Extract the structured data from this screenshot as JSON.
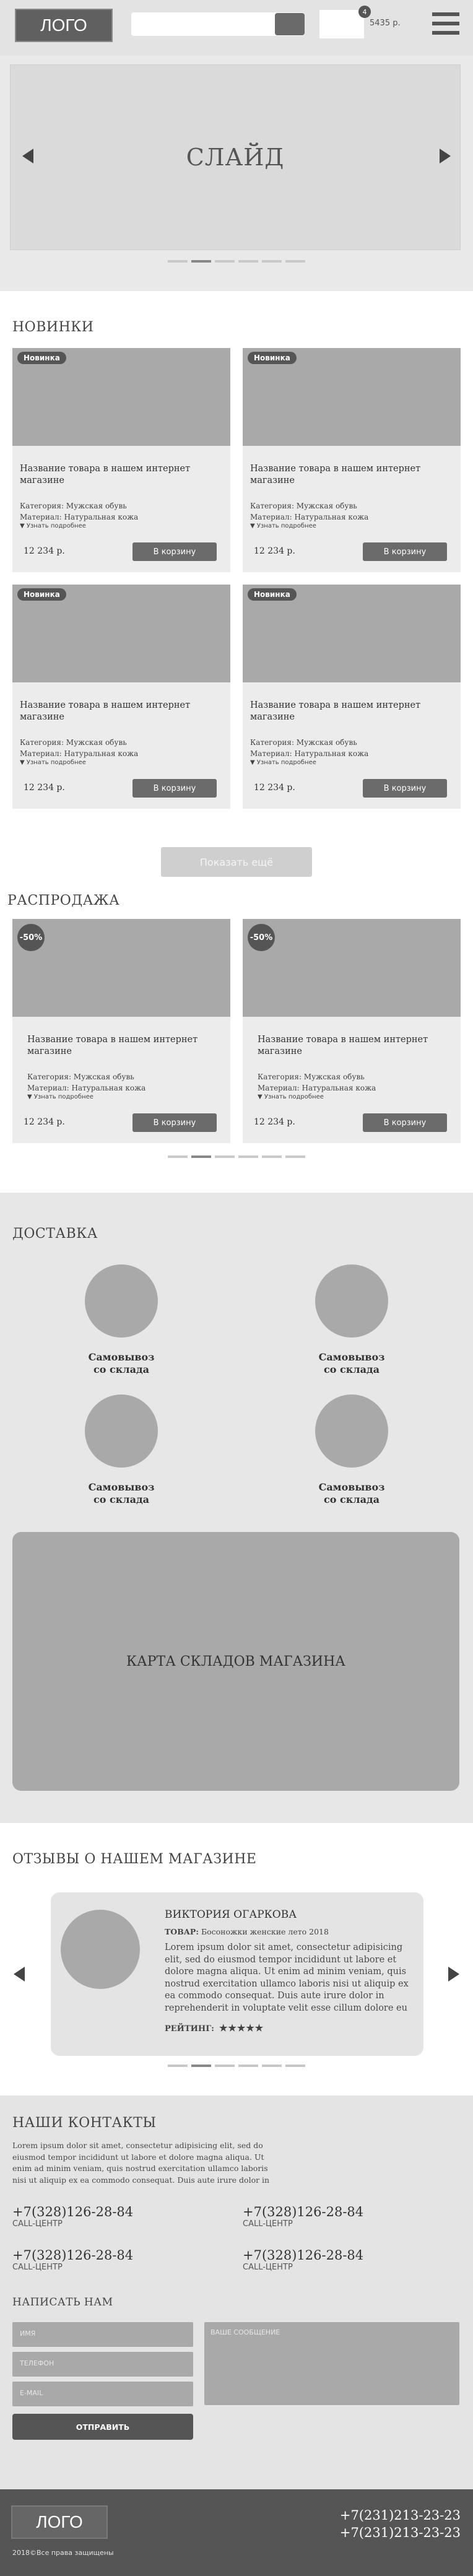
{
  "header": {
    "logo": "ЛОГО",
    "cart_count": "4",
    "cart_sum": "5435 р."
  },
  "slider": {
    "text": "СЛАЙД"
  },
  "new_products": {
    "title": "НОВИНКИ",
    "badge": "Новинка",
    "cards": [
      {
        "name": "Название товара в нашем интернет магазине",
        "category": "Категория: Мужская обувь",
        "material": "Материал: Натуральная кожа",
        "more": "▼ Узнать подробнее",
        "price": "12 234 р.",
        "button": "В корзину"
      },
      {
        "name": "Название товара в нашем интернет магазине",
        "category": "Категория: Мужская обувь",
        "material": "Материал: Натуральная кожа",
        "more": "▼ Узнать подробнее",
        "price": "12 234 р.",
        "button": "В корзину"
      },
      {
        "name": "Название товара в нашем интернет магазине",
        "category": "Категория: Мужская обувь",
        "material": "Материал: Натуральная кожа",
        "more": "▼ Узнать подробнее",
        "price": "12 234 р.",
        "button": "В корзину"
      },
      {
        "name": "Название товара в нашем интернет магазине",
        "category": "Категория: Мужская обувь",
        "material": "Материал: Натуральная кожа",
        "more": "▼ Узнать подробнее",
        "price": "12 234 р.",
        "button": "В корзину"
      }
    ],
    "show_more": "Показать ещё"
  },
  "sale": {
    "title": "РАСПРОДАЖА",
    "badge": "-50%",
    "cards": [
      {
        "name": "Название товара в нашем интернет магазине",
        "category": "Категория: Мужская обувь",
        "material": "Материал: Натуральная кожа",
        "more": "▼ Узнать подробнее",
        "price": "12 234 р.",
        "button": "В корзину"
      },
      {
        "name": "Название товара в нашем интернет магазине",
        "category": "Категория: Мужская обувь",
        "material": "Материал: Натуральная кожа",
        "more": "▼ Узнать подробнее",
        "price": "12 234 р.",
        "button": "В корзину"
      }
    ]
  },
  "delivery": {
    "title": "ДОСТАВКА",
    "items": [
      {
        "line1": "Самовывоз",
        "line2": "со склада"
      },
      {
        "line1": "Самовывоз",
        "line2": "со склада"
      },
      {
        "line1": "Самовывоз",
        "line2": "со склада"
      },
      {
        "line1": "Самовывоз",
        "line2": "со склада"
      }
    ],
    "map": "КАРТА СКЛАДОВ МАГАЗИНА"
  },
  "reviews": {
    "title": "ОТЗЫВЫ О НАШЕМ МАГАЗИНЕ",
    "name": "ВИКТОРИЯ ОГАРКОВА",
    "product_label": "ТОВАР:",
    "product": "Босоножки женские лето 2018",
    "text": "Lorem ipsum dolor sit amet, consectetur adipisicing elit, sed do eiusmod tempor incididunt ut labore et dolore magna aliqua. Ut enim ad minim veniam, quis nostrud exercitation ullamco laboris nisi ut aliquip ex ea commodo consequat. Duis aute irure dolor in reprehenderit in voluptate velit esse cillum dolore eu",
    "rating_label": "РЕЙТИНГ:",
    "stars": "★★★★★"
  },
  "contacts": {
    "title": "НАШИ КОНТАКТЫ",
    "text": "Lorem ipsum dolor sit amet, consectetur adipisicing elit, sed do eiusmod tempor incididunt ut labore et dolore magna aliqua. Ut enim ad minim veniam, quis nostrud exercitation ullamco laboris nisi ut aliquip ex ea commodo consequat. Duis aute irure dolor in",
    "phones": [
      {
        "number": "+7(328)126-28-84",
        "label": "CALL-ЦЕНТР"
      },
      {
        "number": "+7(328)126-28-84",
        "label": "CALL-ЦЕНТР"
      },
      {
        "number": "+7(328)126-28-84",
        "label": "CALL-ЦЕНТР"
      },
      {
        "number": "+7(328)126-28-84",
        "label": "CALL-ЦЕНТР"
      }
    ],
    "form_title": "НАПИСАТЬ НАМ",
    "name_placeholder": "ИМЯ",
    "phone_placeholder": "ТЕЛЕФОН",
    "email_placeholder": "E-MAIL",
    "message_placeholder": "ВАШЕ СООБЩЕНИЕ",
    "send": "ОТПРАВИТЬ"
  },
  "footer": {
    "logo": "ЛОГО",
    "copyright": "2018©Все права защищены",
    "phone1": "+7(231)213-23-23",
    "phone2": "+7(231)213-23-23"
  }
}
